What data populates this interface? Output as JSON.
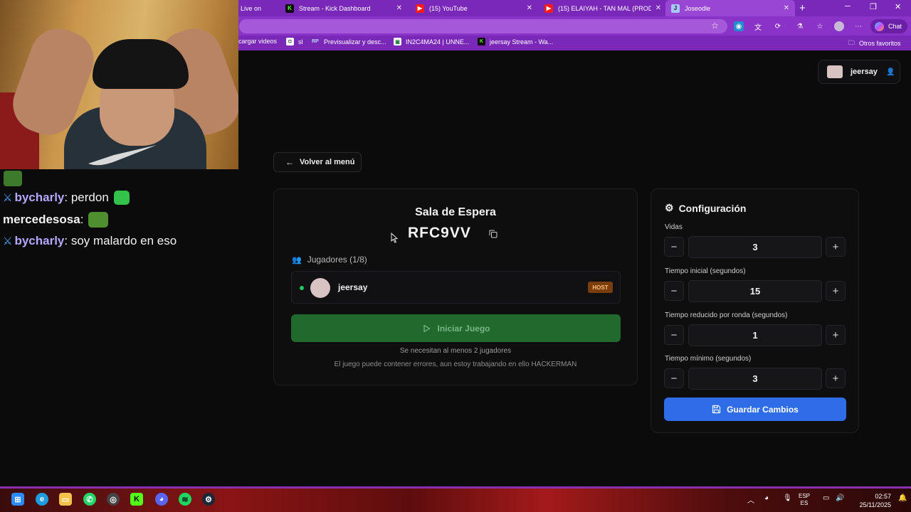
{
  "browser": {
    "tabs": [
      {
        "label": "Live on K",
        "icon": "page-icon"
      },
      {
        "label": "Stream - Kick Dashboard",
        "icon": "kick-icon"
      },
      {
        "label": "(15) YouTube",
        "icon": "youtube-icon"
      },
      {
        "label": "(15) ELAIYAH - TAN MAL (PROD...",
        "icon": "youtube-icon"
      },
      {
        "label": "Joseodle",
        "icon": "joseodle-icon"
      }
    ],
    "chat_button_label": "Chat",
    "bookmarks": [
      {
        "label": "cargar videos"
      },
      {
        "label": "sl"
      },
      {
        "label": "Previsualizar y desc..."
      },
      {
        "label": "IN2C4MA24 | UNNE..."
      },
      {
        "label": "jeersay Stream - Wa..."
      }
    ],
    "other_bookmarks_label": "Otros favoritos"
  },
  "stream_chat": [
    {
      "user": "bycharly",
      "message": "perdon",
      "badge": true
    },
    {
      "user": "mercedesosa",
      "message": "",
      "badge": false
    },
    {
      "user": "bycharly",
      "message": "soy malardo en eso",
      "badge": true
    }
  ],
  "app": {
    "user_chip": {
      "username": "jeersay"
    },
    "back_button_label": "Volver al menú",
    "lobby": {
      "title": "Sala de Espera",
      "room_code": "RFC9VV",
      "players_header": "Jugadores (1/8)",
      "players": [
        {
          "name": "jeersay",
          "badge": "HOST",
          "online": true
        }
      ],
      "start_button_label": "Iniciar Juego",
      "note_min_players": "Se necesitan al menos 2 jugadores",
      "note_warning": "El juego puede contener errores, aun estoy trabajando en ello HACKERMAN"
    },
    "config": {
      "title": "Configuración",
      "fields": [
        {
          "label": "Vidas",
          "value": "3"
        },
        {
          "label": "Tiempo inicial (segundos)",
          "value": "15"
        },
        {
          "label": "Tiempo reducido por ronda (segundos)",
          "value": "1"
        },
        {
          "label": "Tiempo mínimo (segundos)",
          "value": "3"
        }
      ],
      "save_button_label": "Guardar Cambios"
    }
  },
  "taskbar": {
    "language_top": "ESP",
    "language_bottom": "ES",
    "time": "02:57",
    "date": "25/11/2025"
  },
  "colors": {
    "browser_purple": "#7a28b8",
    "start_green": "#1f6a2c",
    "save_blue": "#2f6de8",
    "host_orange": "#7a3d0e",
    "online_green": "#22c55e"
  }
}
